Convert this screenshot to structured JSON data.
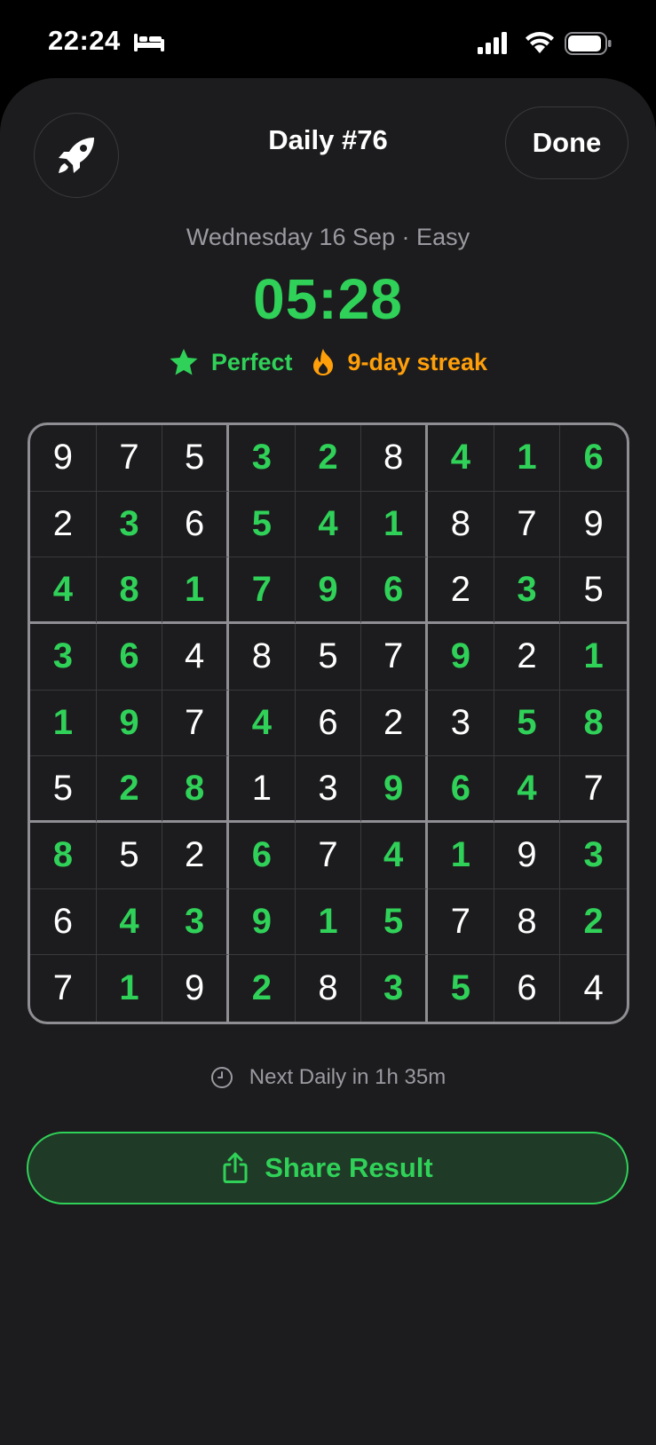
{
  "status_bar": {
    "time": "22:24",
    "icons": [
      "bed-icon",
      "cellular-signal-icon",
      "wifi-icon",
      "battery-icon"
    ]
  },
  "header": {
    "left_icon": "rocket-icon",
    "title": "Daily #76",
    "done_label": "Done"
  },
  "summary": {
    "subtitle": "Wednesday 16 Sep · Easy",
    "time": "05:28",
    "perfect_label": "Perfect",
    "streak_label": "9-day streak"
  },
  "board": {
    "rows": [
      [
        9,
        7,
        5,
        3,
        2,
        8,
        4,
        1,
        6
      ],
      [
        2,
        3,
        6,
        5,
        4,
        1,
        8,
        7,
        9
      ],
      [
        4,
        8,
        1,
        7,
        9,
        6,
        2,
        3,
        5
      ],
      [
        3,
        6,
        4,
        8,
        5,
        7,
        9,
        2,
        1
      ],
      [
        1,
        9,
        7,
        4,
        6,
        2,
        3,
        5,
        8
      ],
      [
        5,
        2,
        8,
        1,
        3,
        9,
        6,
        4,
        7
      ],
      [
        8,
        5,
        2,
        6,
        7,
        4,
        1,
        9,
        3
      ],
      [
        6,
        4,
        3,
        9,
        1,
        5,
        7,
        8,
        2
      ],
      [
        7,
        1,
        9,
        2,
        8,
        3,
        5,
        6,
        4
      ]
    ],
    "entered": [
      [
        0,
        0,
        0,
        1,
        1,
        0,
        1,
        1,
        1
      ],
      [
        0,
        1,
        0,
        1,
        1,
        1,
        0,
        0,
        0
      ],
      [
        1,
        1,
        1,
        1,
        1,
        1,
        0,
        1,
        0
      ],
      [
        1,
        1,
        0,
        0,
        0,
        0,
        1,
        0,
        1
      ],
      [
        1,
        1,
        0,
        1,
        0,
        0,
        0,
        1,
        1
      ],
      [
        0,
        1,
        1,
        0,
        0,
        1,
        1,
        1,
        0
      ],
      [
        1,
        0,
        0,
        1,
        0,
        1,
        1,
        0,
        1
      ],
      [
        0,
        1,
        1,
        1,
        1,
        1,
        0,
        0,
        1
      ],
      [
        0,
        1,
        0,
        1,
        0,
        1,
        1,
        0,
        0
      ]
    ]
  },
  "footer": {
    "next_daily": "Next Daily in 1h 35m",
    "share_label": "Share Result"
  },
  "colors": {
    "accent": "#30d158",
    "streak": "#ff9f0a",
    "background": "#1c1c1e"
  }
}
